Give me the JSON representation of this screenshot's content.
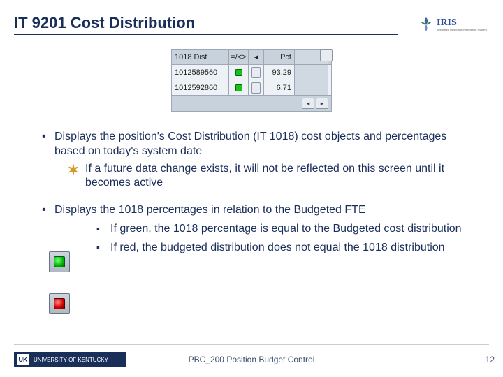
{
  "header": {
    "title": "IT 9201 Cost Distribution",
    "logo_text": "IRIS",
    "logo_sub": "Integrated Resource Information System"
  },
  "widget": {
    "head": {
      "c1": "1018 Dist",
      "c2": "=/<>",
      "c4": "Pct"
    },
    "rows": [
      {
        "id": "1012589560",
        "pct": "93.29"
      },
      {
        "id": "1012592860",
        "pct": "6.71"
      }
    ]
  },
  "bullets": {
    "b1": "Displays the position's Cost Distribution (IT 1018) cost objects and percentages based on today's system date",
    "b1_star": "If a future data change exists, it will not be reflected on this screen until it becomes active",
    "b2": "Displays the 1018 percentages in relation to the Budgeted FTE",
    "b2_green": "If green, the 1018 percentage is equal to the Budgeted cost distribution",
    "b2_red": "If red, the budgeted distribution does not equal the 1018 distribution"
  },
  "footer": {
    "org": "UNIVERSITY OF KENTUCKY",
    "org_badge": "UK",
    "center": "PBC_200 Position Budget Control",
    "page": "12"
  }
}
